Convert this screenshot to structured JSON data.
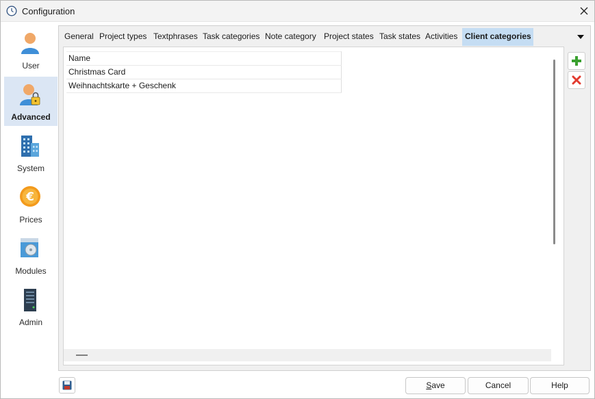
{
  "window": {
    "title": "Configuration"
  },
  "sidebar": {
    "items": [
      {
        "label": "User",
        "icon": "user-icon"
      },
      {
        "label": "Advanced",
        "icon": "user-lock-icon",
        "active": true
      },
      {
        "label": "System",
        "icon": "building-icon"
      },
      {
        "label": "Prices",
        "icon": "euro-coin-icon"
      },
      {
        "label": "Modules",
        "icon": "modules-icon"
      },
      {
        "label": "Admin",
        "icon": "server-icon"
      }
    ]
  },
  "tabs": [
    {
      "label": "General"
    },
    {
      "label": "Project types"
    },
    {
      "label": "Textphrases"
    },
    {
      "label": "Task categories"
    },
    {
      "label": "Note category"
    },
    {
      "label": "Project states"
    },
    {
      "label": "Task states"
    },
    {
      "label": "Activities"
    },
    {
      "label": "Client categories",
      "active": true
    }
  ],
  "grid": {
    "header": "Name",
    "rows": [
      "Christmas Card",
      "Weihnachtskarte + Geschenk"
    ]
  },
  "footer": {
    "save_first": "S",
    "save_rest": "ave",
    "cancel": "Cancel",
    "help": "Help"
  },
  "colors": {
    "active_tab": "#c5ddf3",
    "active_sidebar": "#dbe6f4",
    "add_green": "#3aa02f",
    "delete_red": "#e23a2e"
  }
}
